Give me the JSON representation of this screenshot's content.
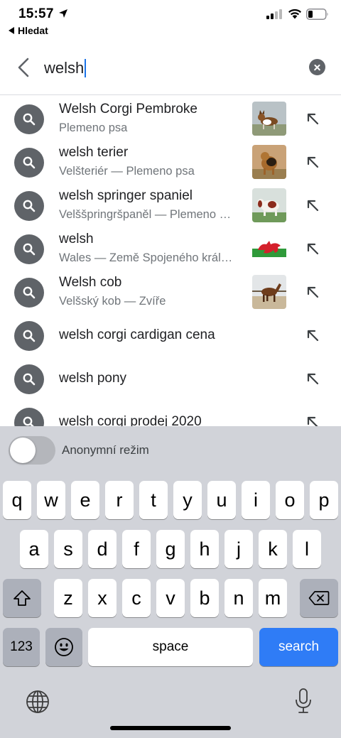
{
  "status_bar": {
    "time": "15:57",
    "back_app_label": "Hledat"
  },
  "search": {
    "value": "welsh"
  },
  "suggestions": [
    {
      "title": "Welsh Corgi Pembroke",
      "subtitle": "Plemeno psa",
      "thumb": "corgi"
    },
    {
      "title": "welsh terier",
      "subtitle": "Velšteriér — Plemeno psa",
      "thumb": "terrier"
    },
    {
      "title": "welsh springer spaniel",
      "subtitle": "Velššpringršpaněl — Plemeno psa",
      "thumb": "spaniel"
    },
    {
      "title": "welsh",
      "subtitle": "Wales — Země Spojeného království",
      "thumb": "flag"
    },
    {
      "title": "Welsh cob",
      "subtitle": "Velšský kob — Zvíře",
      "thumb": "horse"
    },
    {
      "title": "welsh corgi cardigan cena",
      "subtitle": null,
      "thumb": null
    },
    {
      "title": "welsh pony",
      "subtitle": null,
      "thumb": null
    },
    {
      "title": "welsh corgi prodej 2020",
      "subtitle": null,
      "thumb": null
    }
  ],
  "incognito": {
    "label": "Anonymní režim",
    "enabled": false
  },
  "keyboard": {
    "row1": [
      "q",
      "w",
      "e",
      "r",
      "t",
      "y",
      "u",
      "i",
      "o",
      "p"
    ],
    "row2": [
      "a",
      "s",
      "d",
      "f",
      "g",
      "h",
      "j",
      "k",
      "l"
    ],
    "row3": [
      "z",
      "x",
      "c",
      "v",
      "b",
      "n",
      "m"
    ],
    "numbers_key": "123",
    "space_key": "space",
    "search_key": "search"
  },
  "colors": {
    "accent": "#1a73e8",
    "search_key": "#2f7cf6",
    "keyboard_bg": "#d1d3d9",
    "icon_gray": "#5f6368"
  }
}
